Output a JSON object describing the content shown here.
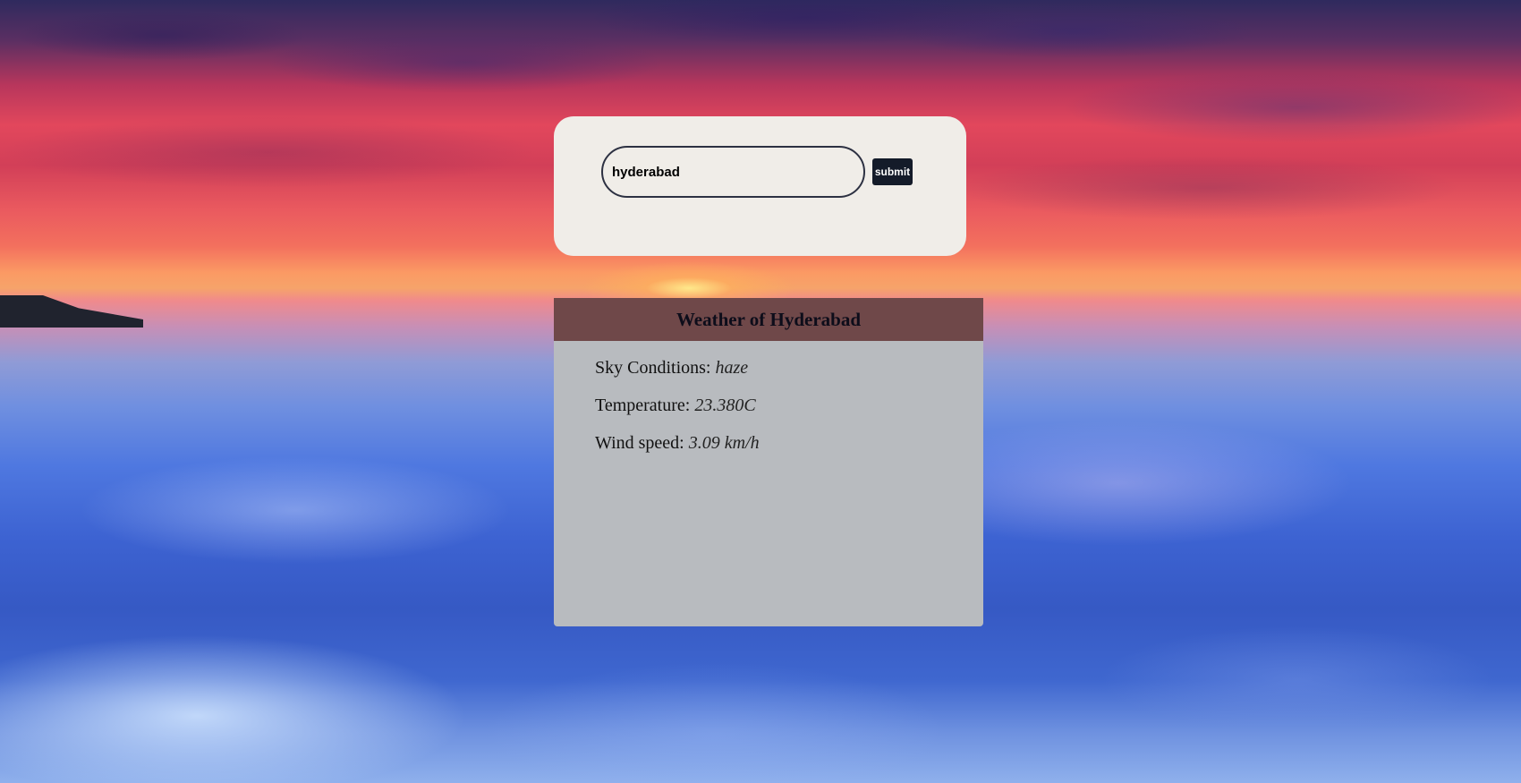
{
  "search": {
    "value": "hyderabad",
    "button_label": "submit"
  },
  "weather": {
    "title": "Weather of Hyderabad",
    "rows": [
      {
        "label": "Sky Conditions: ",
        "value": "haze"
      },
      {
        "label": "Temperature: ",
        "value": "23.380C"
      },
      {
        "label": "Wind speed: ",
        "value": "3.09 km/h"
      }
    ]
  },
  "colors": {
    "card_background": "#f0ede8",
    "button_background": "#141b29",
    "weather_header": "#6f4849",
    "weather_body": "#b8bbbf"
  }
}
